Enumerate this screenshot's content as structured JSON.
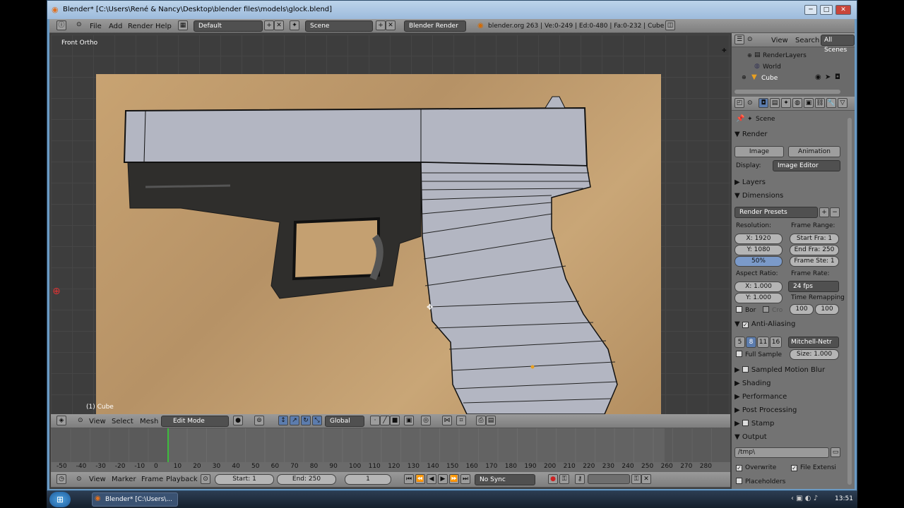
{
  "window": {
    "title": "Blender* [C:\\Users\\René & Nancy\\Desktop\\blender files\\models\\glock.blend]",
    "min": "─",
    "max": "□",
    "close": "✕"
  },
  "top_header": {
    "menus": [
      "File",
      "Add",
      "Render",
      "Help"
    ],
    "layout": "Default",
    "scene": "Scene",
    "engine": "Blender Render",
    "stats": "blender.org 263 | Ve:0-249 | Ed:0-480 | Fa:0-232 | Cube"
  },
  "viewport": {
    "view_label": "Front Ortho",
    "object_label": "(1) Cube"
  },
  "viewport_header": {
    "menus": [
      "View",
      "Select",
      "Mesh"
    ],
    "mode": "Edit Mode",
    "orientation": "Global"
  },
  "outliner": {
    "menus": [
      "View",
      "Search"
    ],
    "filter": "All Scenes",
    "items": [
      "RenderLayers",
      "World",
      "Cube"
    ]
  },
  "properties": {
    "context": "Scene",
    "render_label": "Render",
    "image_button": "Image",
    "animation_button": "Animation",
    "display_label": "Display:",
    "display_value": "Image Editor",
    "layers": "Layers",
    "dimensions": "Dimensions",
    "render_presets": "Render Presets",
    "resolution_label": "Resolution:",
    "res_x": "X: 1920",
    "res_y": "Y: 1080",
    "res_pct": "50%",
    "frame_range_label": "Frame Range:",
    "start": "Start Fra: 1",
    "end": "End Fra: 250",
    "step": "Frame Ste: 1",
    "aspect_label": "Aspect Ratio:",
    "asp_x": "X: 1.000",
    "asp_y": "Y: 1.000",
    "frame_rate_label": "Frame Rate:",
    "fps": "24 fps",
    "time_remap_label": "Time Remapping",
    "remap_old": "100",
    "remap_new": "100",
    "border": "Bor",
    "crop": "Cro",
    "anti_aliasing": "Anti-Aliasing",
    "aa_samples": [
      "5",
      "8",
      "11",
      "16"
    ],
    "aa_filter": "Mitchell-Netr",
    "full_sample": "Full Sample",
    "aa_size": "Size: 1.000",
    "sampled_motion_blur": "Sampled Motion Blur",
    "shading": "Shading",
    "performance": "Performance",
    "post_processing": "Post Processing",
    "stamp": "Stamp",
    "output": "Output",
    "output_path": "/tmp\\",
    "overwrite": "Overwrite",
    "file_extensions": "File Extensi",
    "placeholders": "Placeholders"
  },
  "timeline": {
    "ruler": [
      "-50",
      "-40",
      "-30",
      "-20",
      "-10",
      "0",
      "10",
      "20",
      "30",
      "40",
      "50",
      "60",
      "70",
      "80",
      "90",
      "100",
      "110",
      "120",
      "130",
      "140",
      "150",
      "160",
      "170",
      "180",
      "190",
      "200",
      "210",
      "220",
      "230",
      "240",
      "250",
      "260",
      "270",
      "280"
    ],
    "menus": [
      "View",
      "Marker",
      "Frame",
      "Playback"
    ],
    "start": "Start: 1",
    "end": "End: 250",
    "current": "1",
    "sync": "No Sync"
  },
  "taskbar": {
    "task": "Blender* [C:\\Users\\...",
    "clock": "13:51"
  }
}
